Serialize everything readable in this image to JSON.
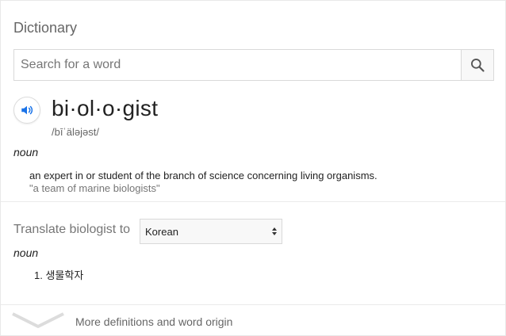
{
  "dictionary": {
    "title": "Dictionary",
    "search": {
      "placeholder": "Search for a word",
      "value": ""
    },
    "entry": {
      "word": "bi·ol·o·gist",
      "phonetic": "/bīˈäləjəst/",
      "part_of_speech": "noun",
      "definition": "an expert in or student of the branch of science concerning living organisms.",
      "example": "\"a team of marine biologists\""
    },
    "translate": {
      "label": "Translate biologist to",
      "selected_language": "Korean",
      "part_of_speech": "noun",
      "items": [
        "1. 생물학자"
      ]
    },
    "more_link": "More definitions and word origin",
    "icons": {
      "search": "search-icon",
      "audio": "speaker-icon",
      "expand": "chevron-down-icon",
      "select": "updown-arrows-icon"
    },
    "colors": {
      "audio_accent": "#1a73e8",
      "muted_text": "#767676"
    }
  }
}
